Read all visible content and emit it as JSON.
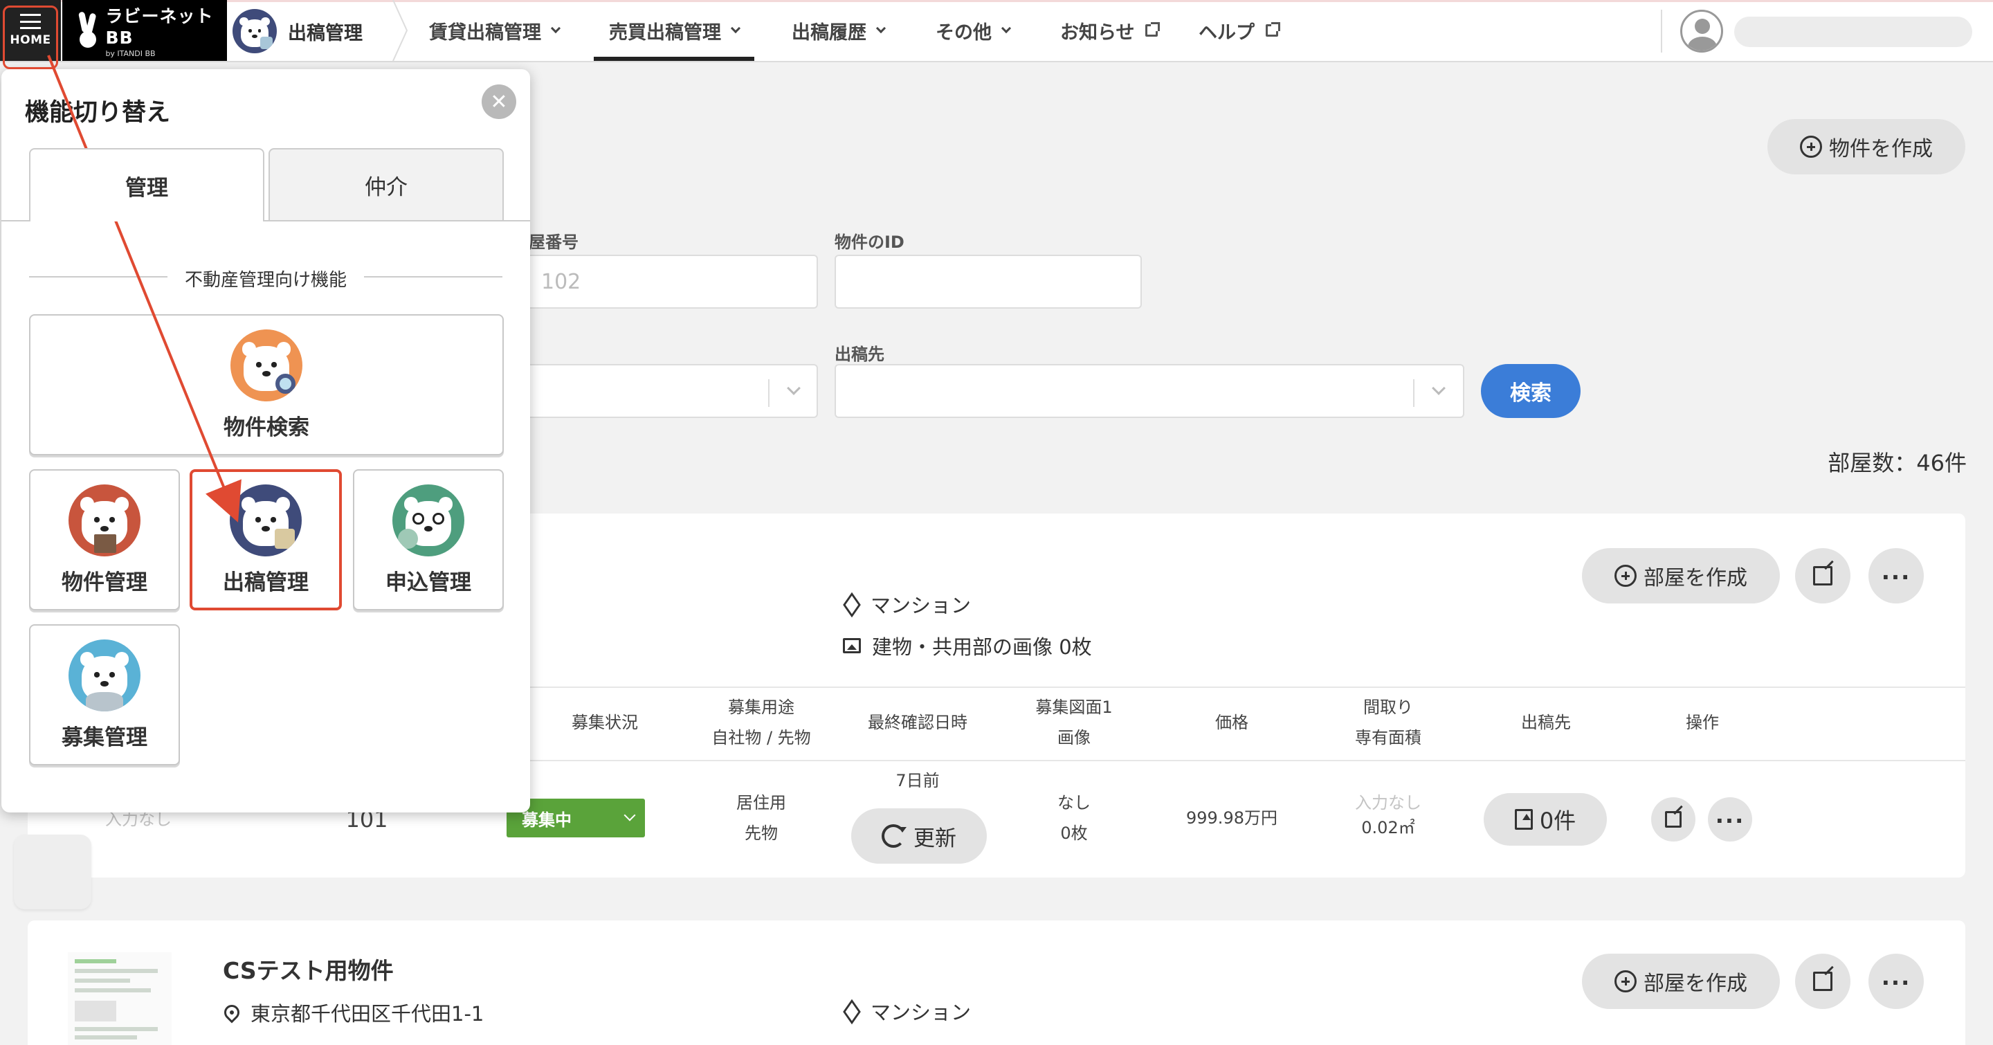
{
  "header": {
    "home_label": "HOME",
    "logo_main": "ラビーネットBB",
    "logo_sub": "by ITANDI BB",
    "current_function": "出稿管理",
    "nav": [
      {
        "label": "賃貸出稿管理",
        "type": "dropdown"
      },
      {
        "label": "売買出稿管理",
        "type": "dropdown",
        "active": true
      },
      {
        "label": "出稿履歴",
        "type": "dropdown"
      },
      {
        "label": "その他",
        "type": "dropdown"
      },
      {
        "label": "お知らせ",
        "type": "external"
      },
      {
        "label": "ヘルプ",
        "type": "external"
      }
    ]
  },
  "toolbar": {
    "create_property": "物件を作成"
  },
  "search": {
    "room_number_label": "屋番号",
    "room_number_placeholder": "102",
    "property_id_label": "物件のID",
    "destination_label": "出稿先",
    "search_button": "検索"
  },
  "summary": {
    "room_count": "部屋数：46件"
  },
  "cards": [
    {
      "create_room": "部屋を作成",
      "building_type": "マンション",
      "images": "建物・共用部の画像 0枚",
      "table_headers": {
        "status": "募集状況",
        "usage_1": "募集用途",
        "usage_2": "自社物 / 先物",
        "last_checked": "最終確認日時",
        "floorplan_1": "募集図面1",
        "floorplan_2": "画像",
        "price": "価格",
        "layout_1": "間取り",
        "layout_2": "専有面積",
        "destination": "出稿先",
        "actions": "操作"
      },
      "row": {
        "note": "入力なし",
        "room": "101",
        "status": "募集中",
        "usage_1": "居住用",
        "usage_2": "先物",
        "last_checked": "7日前",
        "update_button": "更新",
        "floorplan_1": "なし",
        "floorplan_2": "0枚",
        "price": "999.98万円",
        "layout_1": "入力なし",
        "layout_2": "0.02㎡",
        "destination_count": "0件"
      }
    },
    {
      "title": "CSテスト用物件",
      "address": "東京都千代田区千代田1-1",
      "create_room": "部屋を作成",
      "building_type": "マンション"
    }
  ],
  "panel": {
    "title": "機能切り替え",
    "tabs": [
      {
        "label": "管理",
        "active": true
      },
      {
        "label": "仲介",
        "active": false
      }
    ],
    "section_title": "不動産管理向け機能",
    "tiles": [
      {
        "label": "物件検索",
        "icon": "bear-magnifier-icon",
        "color": "#ef9352"
      },
      {
        "label": "物件管理",
        "icon": "bear-house-icon",
        "color": "#c8553d"
      },
      {
        "label": "出稿管理",
        "icon": "bear-publish-icon",
        "color": "#3f4b7a",
        "highlighted": true
      },
      {
        "label": "申込管理",
        "icon": "bear-glasses-icon",
        "color": "#4e9e7e"
      },
      {
        "label": "募集管理",
        "icon": "bear-recruit-icon",
        "color": "#5ab2d6"
      }
    ]
  },
  "colors": {
    "accent_blue": "#3b7dd8",
    "status_green": "#5aa33a",
    "annotation_red": "#e04a32"
  }
}
